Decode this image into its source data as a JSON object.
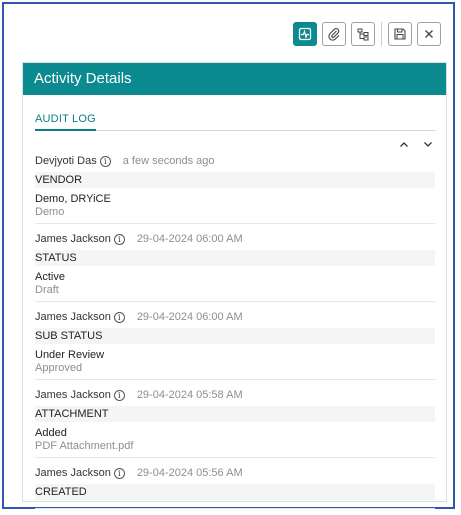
{
  "panel": {
    "title": "Activity Details"
  },
  "tabs": [
    {
      "label": "AUDIT LOG"
    }
  ],
  "toolbar": [
    {
      "name": "activity-button",
      "icon": "activity-icon",
      "active": true
    },
    {
      "name": "attachment-button",
      "icon": "paperclip-icon"
    },
    {
      "name": "hierarchy-button",
      "icon": "hierarchy-icon"
    },
    {
      "name": "save-button",
      "icon": "save-icon"
    },
    {
      "name": "close-button",
      "icon": "close-icon"
    }
  ],
  "entries": [
    {
      "user": "Devjyoti Das",
      "time": "a few seconds ago",
      "field": "VENDOR",
      "new": "Demo, DRYiCE",
      "old": "Demo"
    },
    {
      "user": "James Jackson",
      "time": "29-04-2024 06:00 AM",
      "field": "STATUS",
      "new": "Active",
      "old": "Draft"
    },
    {
      "user": "James Jackson",
      "time": "29-04-2024 06:00 AM",
      "field": "SUB STATUS",
      "new": "Under Review",
      "old": "Approved"
    },
    {
      "user": "James Jackson",
      "time": "29-04-2024 05:58 AM",
      "field": "ATTACHMENT",
      "new": "Added",
      "old": "PDF Attachment.pdf"
    },
    {
      "user": "James Jackson",
      "time": "29-04-2024 05:56 AM",
      "field": "CREATED"
    }
  ],
  "colors": {
    "accent": "#0b8a8f",
    "frame": "#2f56b0",
    "muted": "#8a8f94"
  }
}
